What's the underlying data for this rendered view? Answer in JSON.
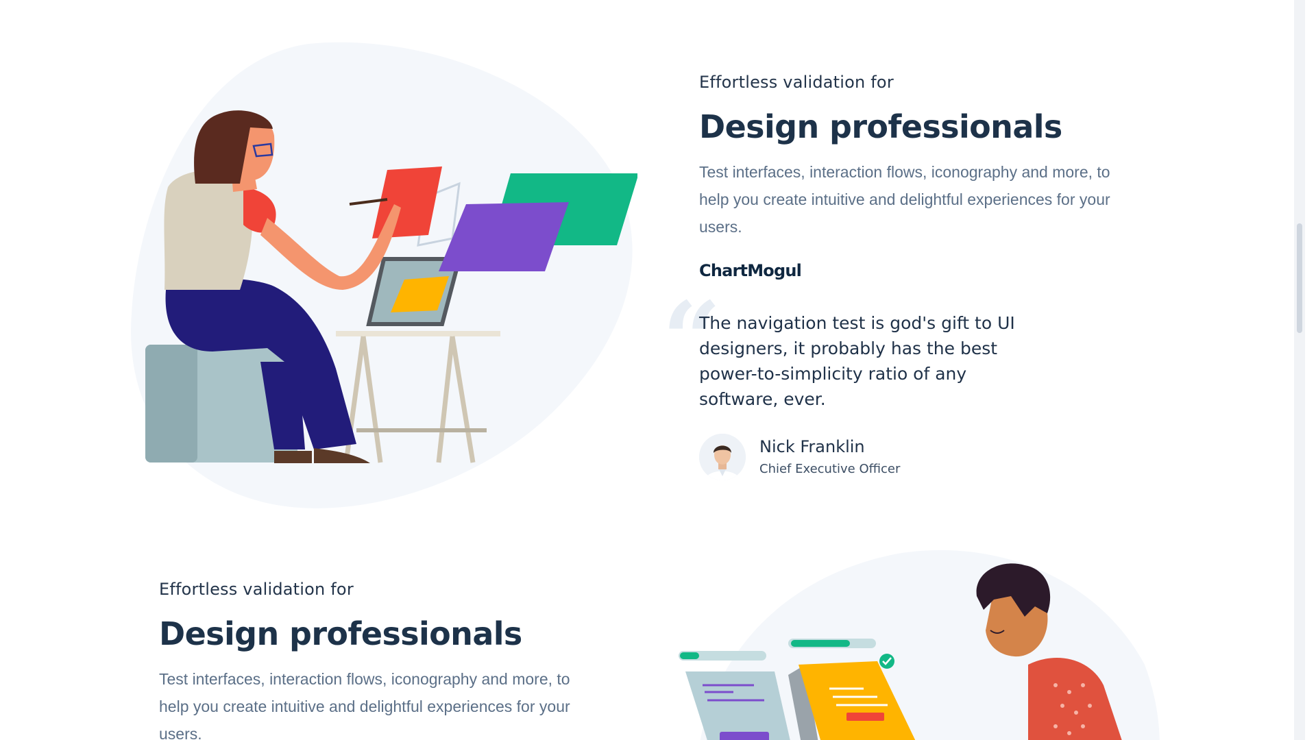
{
  "sections": [
    {
      "eyebrow": "Effortless validation for",
      "heading": "Design professionals",
      "description": "Test interfaces, interaction flows, iconography and more, to help you create intuitive and delightful experiences for your users.",
      "brand": "ChartMogul",
      "quote": "The navigation test is god's gift to UI designers, it probably has the best power-to-simplicity ratio of any software, ever.",
      "author_name": "Nick Franklin",
      "author_role": "Chief Executive Officer"
    },
    {
      "eyebrow": "Effortless validation for",
      "heading": "Design professionals",
      "description": "Test interfaces, interaction flows, iconography and more, to help you create intuitive and delightful experiences for your users."
    }
  ],
  "icons": {
    "quote": "quote-mark-icon",
    "check": "check-badge-icon"
  },
  "colors": {
    "heading": "#1d3249",
    "body": "#5b6f87",
    "blob": "#f4f7fb",
    "red": "#f04438",
    "purple": "#7c4dcc",
    "green": "#12b886",
    "yellow": "#ffb400",
    "navy": "#221c7a"
  }
}
